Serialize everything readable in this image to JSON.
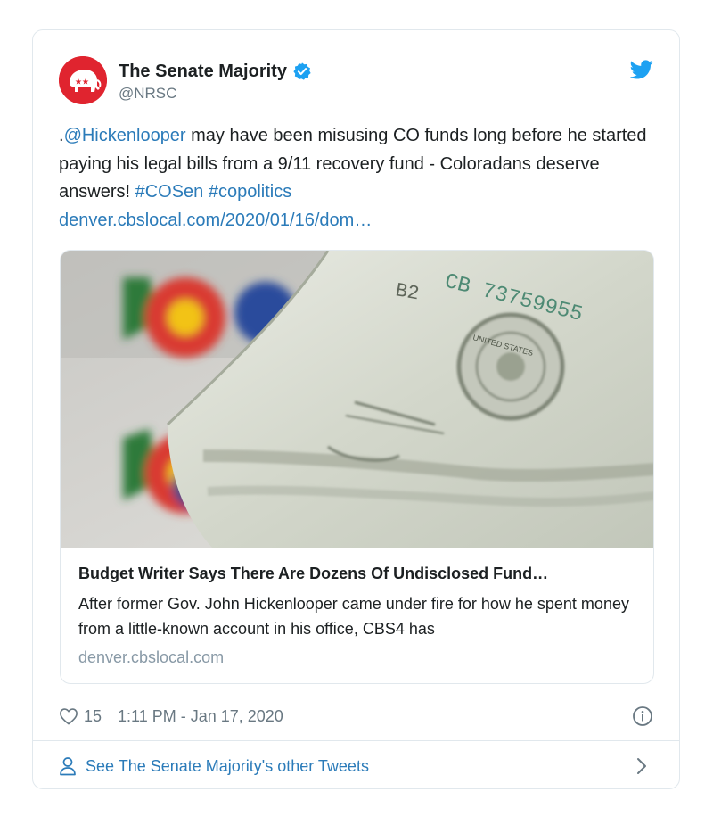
{
  "author": {
    "display_name": "The Senate Majority",
    "handle": "@NRSC",
    "verified": true,
    "avatar_color": "#e0242f"
  },
  "tweet": {
    "prefix": ".",
    "mention": "@Hickenlooper",
    "body": " may have been misusing CO funds long before he started paying his legal bills from a 9/11 recovery fund - Coloradans deserve answers! ",
    "hashtag_1": "#COSen",
    "hashtag_2": "#copolitics",
    "url": "denver.cbslocal.com/2020/01/16/dom…"
  },
  "card": {
    "image_text_serial": "CB 73759955",
    "image_text_series": "B2",
    "image_text_seal": "UNITED STATES",
    "title": "Budget Writer Says There Are Dozens Of Undisclosed Fund…",
    "description": "After former Gov. John Hickenlooper came under fire for how he spent money from a little-known account in his office, CBS4 has",
    "domain": "denver.cbslocal.com"
  },
  "meta": {
    "like_count": "15",
    "timestamp": "1:11 PM - Jan 17, 2020"
  },
  "footer": {
    "label": "See The Senate Majority's other Tweets"
  },
  "colors": {
    "link": "#2b7bb9",
    "twitter_blue": "#1da1f2",
    "muted": "#697882"
  }
}
